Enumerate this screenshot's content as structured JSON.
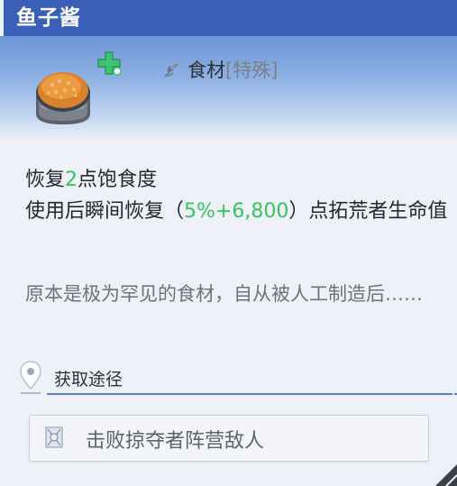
{
  "item": {
    "name": "鱼子酱"
  },
  "type": {
    "icon": "leaf-icon",
    "name": "食材",
    "tag": "[特殊]"
  },
  "badges": {
    "heal_icon": "green-plus-icon"
  },
  "description": {
    "line1_a": "恢复",
    "line1_value": "2",
    "line1_b": "点饱食度",
    "line2_a": "使用后瞬间恢复（",
    "line2_value": "5%+6,800",
    "line2_b": "）点拓荒者生命值"
  },
  "flavor_text": "原本是极为罕见的食材，自从被人工制造后……",
  "source": {
    "icon": "location-pin-icon",
    "label": "获取途径",
    "items": [
      {
        "icon": "crossed-card-icon",
        "label": "击败掠夺者阵营敌人"
      }
    ]
  },
  "colors": {
    "header": "#3a5fb8",
    "highlight": "#37c55f"
  }
}
